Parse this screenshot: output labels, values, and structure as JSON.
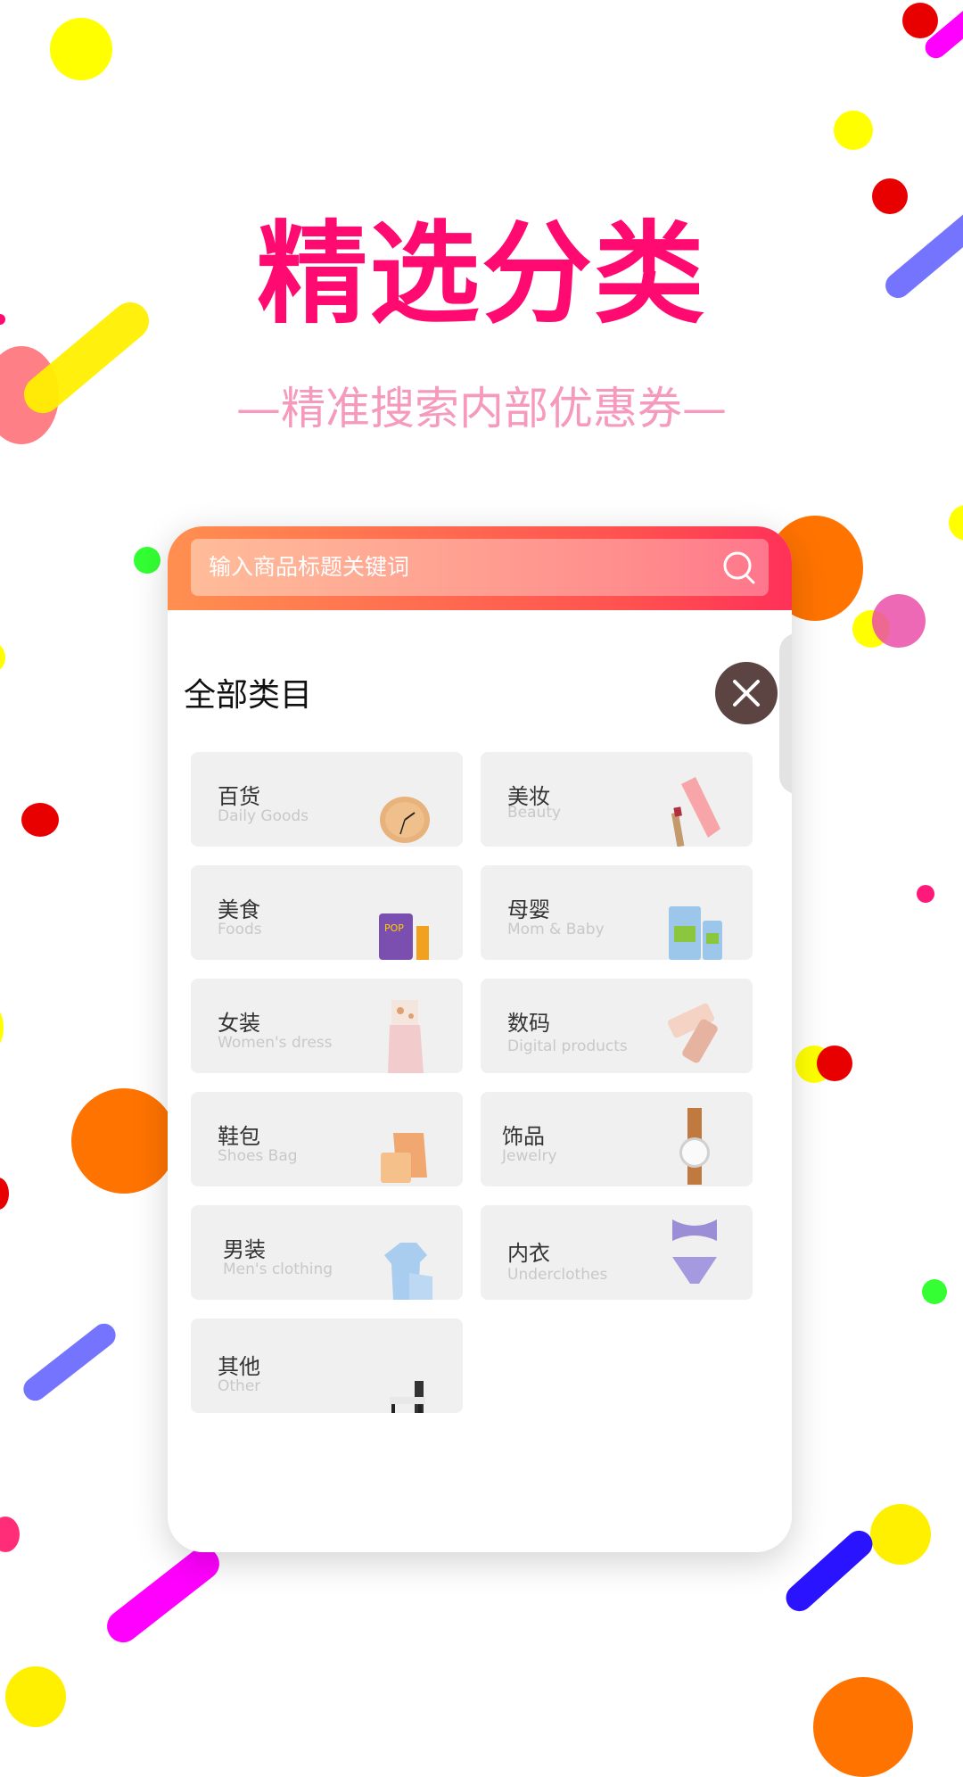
{
  "header": {
    "title": "精选分类",
    "subtitle": "—精准搜索内部优惠券—"
  },
  "search": {
    "placeholder": "输入商品标题关键词",
    "icon": "search-icon"
  },
  "panel": {
    "section_title": "全部类目",
    "close_icon": "close-icon"
  },
  "categories": [
    {
      "cn": "百货",
      "en": "Daily Goods",
      "icon": "clock-icon"
    },
    {
      "cn": "美妆",
      "en": "Beauty",
      "icon": "cosmetics-icon"
    },
    {
      "cn": "美食",
      "en": "Foods",
      "icon": "snack-icon"
    },
    {
      "cn": "母婴",
      "en": "Mom & Baby",
      "icon": "milk-powder-icon"
    },
    {
      "cn": "女装",
      "en": "Women's dress",
      "icon": "dress-icon"
    },
    {
      "cn": "数码",
      "en": "Digital products",
      "icon": "phone-icon"
    },
    {
      "cn": "鞋包",
      "en": "Shoes Bag",
      "icon": "bag-icon"
    },
    {
      "cn": "饰品",
      "en": "Jewelry",
      "icon": "watch-icon"
    },
    {
      "cn": "男装",
      "en": "Men's clothing",
      "icon": "shirt-icon"
    },
    {
      "cn": "内衣",
      "en": "Underclothes",
      "icon": "underwear-icon"
    },
    {
      "cn": "其他",
      "en": "Other",
      "icon": "chair-icon"
    }
  ],
  "colors": {
    "title": "#ff0a70",
    "subtitle": "#f59abc",
    "header_gradient_start": "#ff8f50",
    "header_gradient_end": "#ff3158",
    "close_button": "#5b4442",
    "tile_bg": "#f0f0f0"
  }
}
